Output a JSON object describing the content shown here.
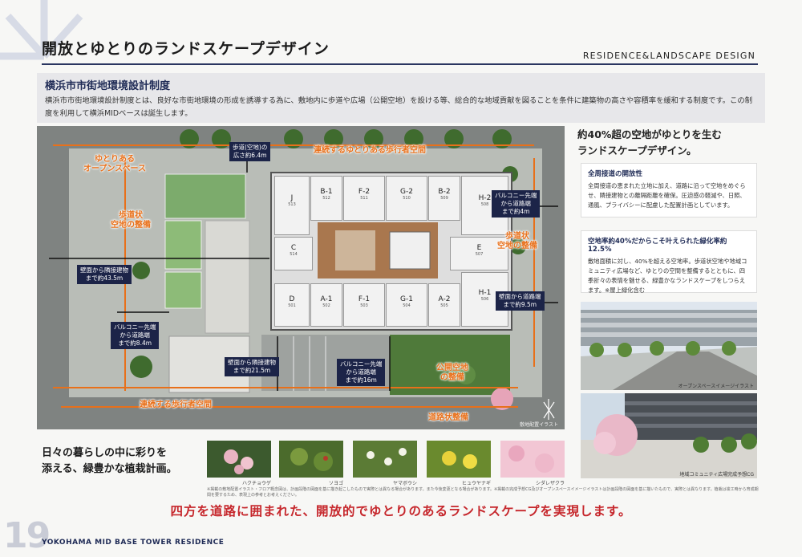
{
  "header": {
    "title": "開放とゆとりのランドスケープデザイン",
    "subtitle": "RESIDENCE&LANDSCAPE DESIGN"
  },
  "intro": {
    "heading": "横浜市市街地環境設計制度",
    "body": "横浜市市街地環境設計制度とは、良好な市街地環境の形成を誘導する為に、敷地内に歩道や広場（公開空地）を設ける等、総合的な地域貢献を図ることを条件に建築物の高さや容積率を緩和する制度です。この制度を利用して横浜MIDベースは誕生します。"
  },
  "map": {
    "labels": {
      "open_space": "ゆとりある\nオープンスペース",
      "walkway_top": "連続するゆとりある歩行者空間",
      "walkway_bottom": "連続する歩行者空間",
      "sidewalk_left": "歩道状\n空地の整備",
      "sidewalk_right": "歩道状\n空地の整備",
      "public_space": "公開空地\nの整備",
      "road_maintenance": "道路状整備"
    },
    "callouts": {
      "walkway_width": "歩道(空地)の\n広さ約6.4m",
      "balcony_top_right": "バルコニー先端\nから道路端\nまで約4m",
      "wall_left": "壁面から隣接建物\nまで約43.5m",
      "wall_right": "壁面から道路端\nまで約9.5m",
      "balcony_left": "バルコニー先端\nから道路端\nまで約8.4m",
      "wall_bottom": "壁面から隣接建物\nまで約21.5m",
      "balcony_bottom": "バルコニー先端\nから道路端\nまで約16m"
    },
    "units": [
      {
        "name": "J",
        "code": "513"
      },
      {
        "name": "B-1",
        "code": "512"
      },
      {
        "name": "F-2",
        "code": "511"
      },
      {
        "name": "G-2",
        "code": "510"
      },
      {
        "name": "B-2",
        "code": "509"
      },
      {
        "name": "H-2",
        "code": "508"
      },
      {
        "name": "C",
        "code": "514"
      },
      {
        "name": "E",
        "code": "507"
      },
      {
        "name": "D",
        "code": "501"
      },
      {
        "name": "A-1",
        "code": "502"
      },
      {
        "name": "F-1",
        "code": "503"
      },
      {
        "name": "G-1",
        "code": "504"
      },
      {
        "name": "A-2",
        "code": "505"
      },
      {
        "name": "H-1",
        "code": "506"
      }
    ],
    "credit": "敷地配置イラスト"
  },
  "right": {
    "heading": "約40%超の空地がゆとりを生む\nランドスケープデザイン。",
    "box1_title": "全周接道の開放性",
    "box1_body": "全周接道の恵まれた立地に加え、道路に沿って空地をめぐらせ、隣接建物との離隔距離を確保。圧迫感の軽減や、日照、通風、プライバシーに配慮した配置計画としています。",
    "box2_title": "空地率約40%だからこそ叶えられた緑化率約12.5%",
    "box2_body": "敷地面積に対し、40%を超える空地率。歩道状空地や地域コミュニティ広場など、ゆとりの空間を整備するとともに、四季折々の表情を魅せる、緑豊かなランドスケープをしつらえます。※屋上緑化含む",
    "photo1_caption": "オープンスペースイメージイラスト",
    "photo2_caption": "地域コミュニティ広場完成予想CG"
  },
  "plants": {
    "title": "日々の暮らしの中に彩りを\n添える、緑豊かな植栽計画。",
    "items": [
      "ハクチョウゲ",
      "ソヨゴ",
      "ヤマボウシ",
      "ヒュウヤナギ",
      "シダレザクラ"
    ]
  },
  "fine_print": "※掲載の敷地配置イラスト・フロア概念図は、計画段階の図面を基に描き起こしたもので実際とは異なる場合があります。また今後変更となる場合があります。※掲載の完成予想CG及びオープンスペースイメージイラストは計画段階の図面を基に描いたもので、実際とは異なります。植栽は竣工時から育成期間を要するため、表現上の参考とお考えください。",
  "tagline": "四方を道路に囲まれた、開放的でゆとりのあるランドスケープを実現します。",
  "footer": {
    "page_number": "19",
    "brand": "YOKOHAMA MID BASE TOWER RESIDENCE"
  },
  "colors": {
    "navy": "#1c2448",
    "accent_orange": "#e8701a",
    "tagline_red": "#c6272c"
  }
}
